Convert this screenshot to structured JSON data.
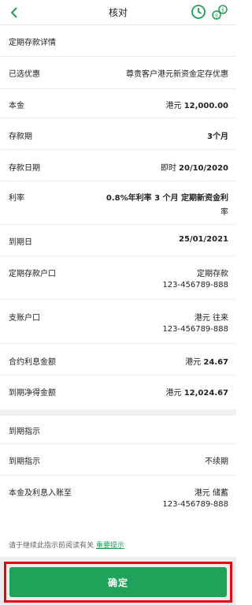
{
  "header": {
    "title": "核对"
  },
  "details": {
    "section_title": "定期存款详情",
    "offer": {
      "label": "已选优惠",
      "value": "尊贵客户港元新资金定存优惠"
    },
    "principal": {
      "label": "本金",
      "currency": "港元",
      "amount": "12,000.00"
    },
    "term": {
      "label": "存款期",
      "value": "3个月"
    },
    "deposit_date": {
      "label": "存款日期",
      "prefix": "即时",
      "date": "20/10/2020"
    },
    "rate": {
      "label": "利率",
      "line1": "0.8%年利率 3 个月 定期新资金利",
      "line2": "率"
    },
    "maturity_date": {
      "label": "到期日",
      "value": "25/01/2021"
    },
    "deposit_account": {
      "label": "定期存款户口",
      "type": "定期存款",
      "number": "123-456789-888"
    },
    "debit_account": {
      "label": "支账户口",
      "type": "港元 往来",
      "number": "123-456789-888"
    },
    "interest": {
      "label": "合约利息金额",
      "currency": "港元",
      "amount": "24.67"
    },
    "net_maturity": {
      "label": "到期净得金额",
      "currency": "港元",
      "amount": "12,024.67"
    }
  },
  "instruction": {
    "section_title": "到期指示",
    "maturity_instruction": {
      "label": "到期指示",
      "value": "不续期"
    },
    "credit_account": {
      "label": "本金及利息入账至",
      "type": "港元 储蓄",
      "number": "123-456789-888"
    }
  },
  "notice": {
    "text": "请于继续此指示前阅读有关",
    "link": "重要提示"
  },
  "confirm_button": {
    "label": "确定"
  }
}
